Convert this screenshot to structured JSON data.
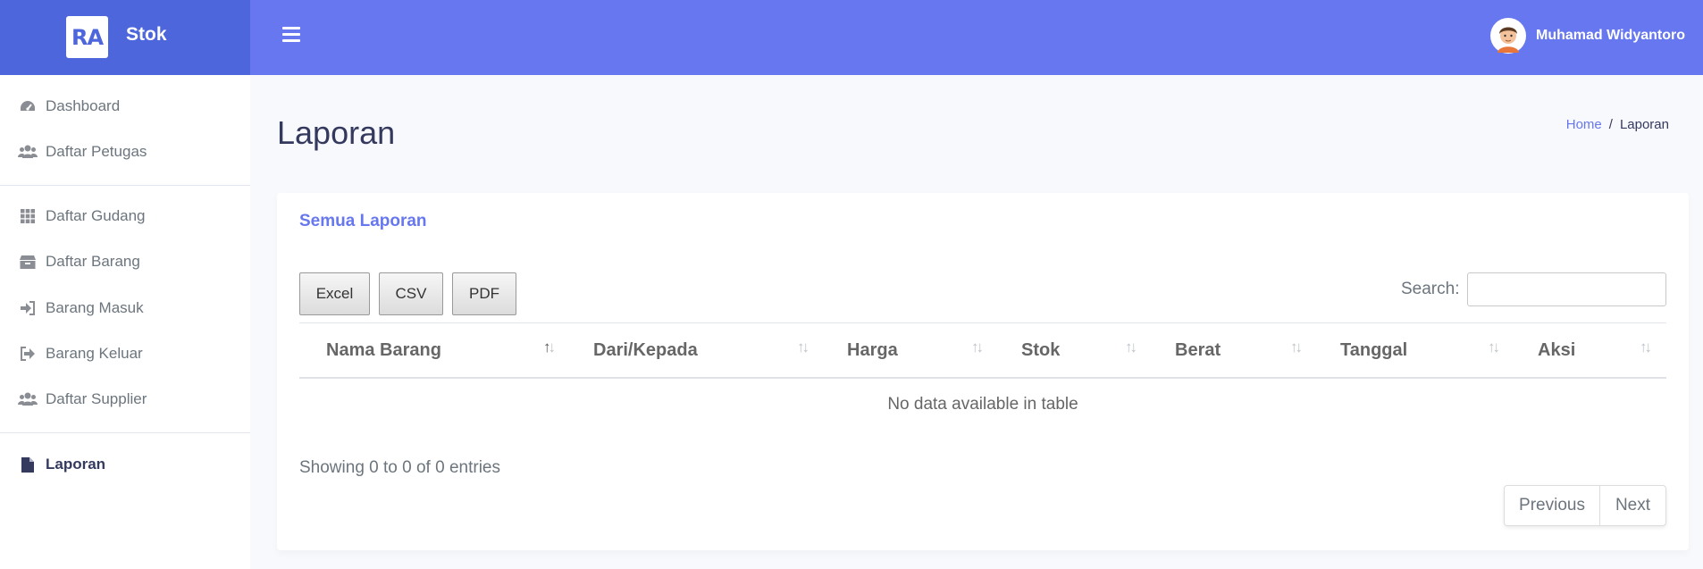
{
  "brand": {
    "logo_text": "RA",
    "name": "Stok"
  },
  "topbar": {
    "user_name": "Muhamad Widyantoro"
  },
  "sidebar": {
    "items": [
      {
        "label": "Dashboard",
        "icon": "gauge-icon"
      },
      {
        "label": "Daftar Petugas",
        "icon": "users-icon"
      },
      {
        "label": "Daftar Gudang",
        "icon": "grid-icon"
      },
      {
        "label": "Daftar Barang",
        "icon": "box-icon"
      },
      {
        "label": "Barang Masuk",
        "icon": "sign-in-icon"
      },
      {
        "label": "Barang Keluar",
        "icon": "sign-out-icon"
      },
      {
        "label": "Daftar Supplier",
        "icon": "users-icon"
      },
      {
        "label": "Laporan",
        "icon": "file-icon",
        "active": true
      }
    ]
  },
  "page": {
    "title": "Laporan",
    "breadcrumb": {
      "home": "Home",
      "separator": "/",
      "current": "Laporan"
    }
  },
  "card": {
    "title": "Semua Laporan",
    "buttons": {
      "excel": "Excel",
      "csv": "CSV",
      "pdf": "PDF"
    },
    "search_label": "Search:",
    "search_value": "",
    "columns": [
      "Nama Barang",
      "Dari/Kepada",
      "Harga",
      "Stok",
      "Berat",
      "Tanggal",
      "Aksi"
    ],
    "empty_message": "No data available in table",
    "info": "Showing 0 to 0 of 0 entries",
    "pagination": {
      "previous": "Previous",
      "next": "Next"
    }
  },
  "colors": {
    "primary": "#6777ef",
    "brand": "#4e66dc",
    "background": "#f8f9fc"
  }
}
